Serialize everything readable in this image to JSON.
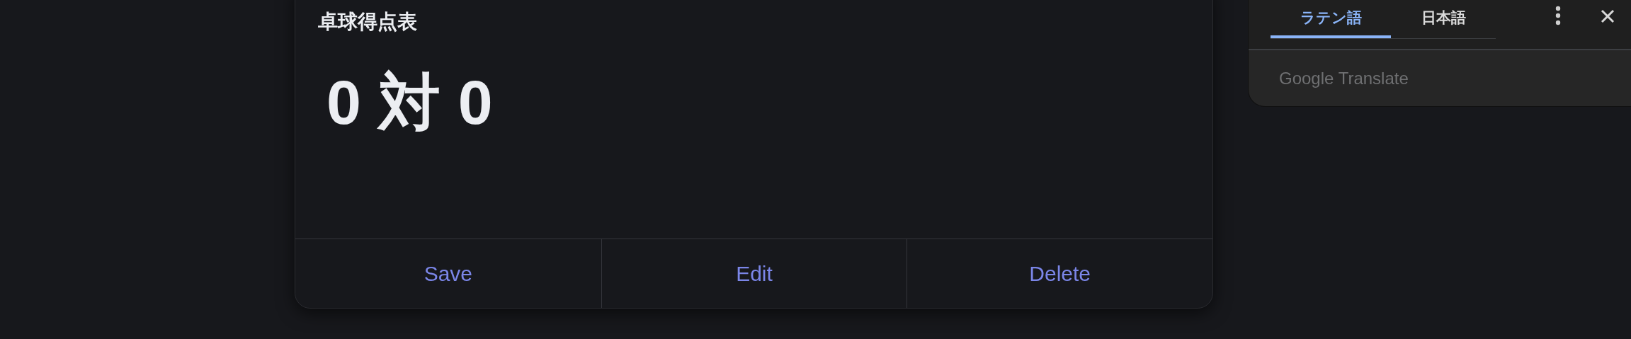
{
  "card": {
    "title": "卓球得点表",
    "score": "0 対 0",
    "actions": [
      "Save",
      "Edit",
      "Delete"
    ]
  },
  "translate_popup": {
    "tabs": [
      {
        "label": "ラテン語",
        "selected": true
      },
      {
        "label": "日本語",
        "selected": false
      }
    ],
    "footer": "Google Translate"
  }
}
